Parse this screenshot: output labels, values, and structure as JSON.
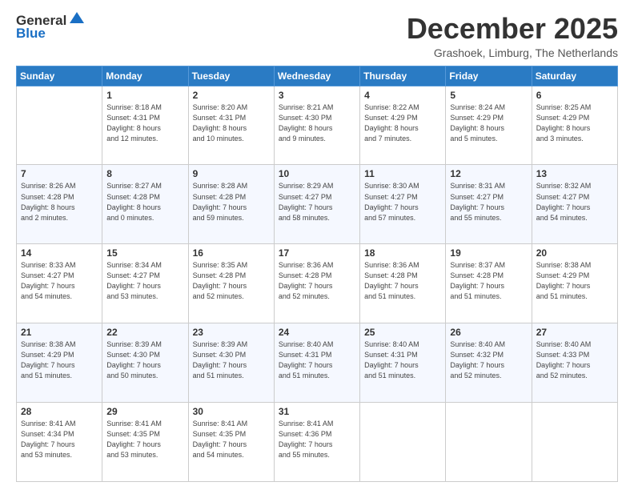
{
  "logo": {
    "line1": "General",
    "line2": "Blue"
  },
  "title": "December 2025",
  "location": "Grashoek, Limburg, The Netherlands",
  "days_of_week": [
    "Sunday",
    "Monday",
    "Tuesday",
    "Wednesday",
    "Thursday",
    "Friday",
    "Saturday"
  ],
  "weeks": [
    [
      {
        "day": "",
        "info": ""
      },
      {
        "day": "1",
        "info": "Sunrise: 8:18 AM\nSunset: 4:31 PM\nDaylight: 8 hours\nand 12 minutes."
      },
      {
        "day": "2",
        "info": "Sunrise: 8:20 AM\nSunset: 4:31 PM\nDaylight: 8 hours\nand 10 minutes."
      },
      {
        "day": "3",
        "info": "Sunrise: 8:21 AM\nSunset: 4:30 PM\nDaylight: 8 hours\nand 9 minutes."
      },
      {
        "day": "4",
        "info": "Sunrise: 8:22 AM\nSunset: 4:29 PM\nDaylight: 8 hours\nand 7 minutes."
      },
      {
        "day": "5",
        "info": "Sunrise: 8:24 AM\nSunset: 4:29 PM\nDaylight: 8 hours\nand 5 minutes."
      },
      {
        "day": "6",
        "info": "Sunrise: 8:25 AM\nSunset: 4:29 PM\nDaylight: 8 hours\nand 3 minutes."
      }
    ],
    [
      {
        "day": "7",
        "info": "Sunrise: 8:26 AM\nSunset: 4:28 PM\nDaylight: 8 hours\nand 2 minutes."
      },
      {
        "day": "8",
        "info": "Sunrise: 8:27 AM\nSunset: 4:28 PM\nDaylight: 8 hours\nand 0 minutes."
      },
      {
        "day": "9",
        "info": "Sunrise: 8:28 AM\nSunset: 4:28 PM\nDaylight: 7 hours\nand 59 minutes."
      },
      {
        "day": "10",
        "info": "Sunrise: 8:29 AM\nSunset: 4:27 PM\nDaylight: 7 hours\nand 58 minutes."
      },
      {
        "day": "11",
        "info": "Sunrise: 8:30 AM\nSunset: 4:27 PM\nDaylight: 7 hours\nand 57 minutes."
      },
      {
        "day": "12",
        "info": "Sunrise: 8:31 AM\nSunset: 4:27 PM\nDaylight: 7 hours\nand 55 minutes."
      },
      {
        "day": "13",
        "info": "Sunrise: 8:32 AM\nSunset: 4:27 PM\nDaylight: 7 hours\nand 54 minutes."
      }
    ],
    [
      {
        "day": "14",
        "info": "Sunrise: 8:33 AM\nSunset: 4:27 PM\nDaylight: 7 hours\nand 54 minutes."
      },
      {
        "day": "15",
        "info": "Sunrise: 8:34 AM\nSunset: 4:27 PM\nDaylight: 7 hours\nand 53 minutes."
      },
      {
        "day": "16",
        "info": "Sunrise: 8:35 AM\nSunset: 4:28 PM\nDaylight: 7 hours\nand 52 minutes."
      },
      {
        "day": "17",
        "info": "Sunrise: 8:36 AM\nSunset: 4:28 PM\nDaylight: 7 hours\nand 52 minutes."
      },
      {
        "day": "18",
        "info": "Sunrise: 8:36 AM\nSunset: 4:28 PM\nDaylight: 7 hours\nand 51 minutes."
      },
      {
        "day": "19",
        "info": "Sunrise: 8:37 AM\nSunset: 4:28 PM\nDaylight: 7 hours\nand 51 minutes."
      },
      {
        "day": "20",
        "info": "Sunrise: 8:38 AM\nSunset: 4:29 PM\nDaylight: 7 hours\nand 51 minutes."
      }
    ],
    [
      {
        "day": "21",
        "info": "Sunrise: 8:38 AM\nSunset: 4:29 PM\nDaylight: 7 hours\nand 51 minutes."
      },
      {
        "day": "22",
        "info": "Sunrise: 8:39 AM\nSunset: 4:30 PM\nDaylight: 7 hours\nand 50 minutes."
      },
      {
        "day": "23",
        "info": "Sunrise: 8:39 AM\nSunset: 4:30 PM\nDaylight: 7 hours\nand 51 minutes."
      },
      {
        "day": "24",
        "info": "Sunrise: 8:40 AM\nSunset: 4:31 PM\nDaylight: 7 hours\nand 51 minutes."
      },
      {
        "day": "25",
        "info": "Sunrise: 8:40 AM\nSunset: 4:31 PM\nDaylight: 7 hours\nand 51 minutes."
      },
      {
        "day": "26",
        "info": "Sunrise: 8:40 AM\nSunset: 4:32 PM\nDaylight: 7 hours\nand 52 minutes."
      },
      {
        "day": "27",
        "info": "Sunrise: 8:40 AM\nSunset: 4:33 PM\nDaylight: 7 hours\nand 52 minutes."
      }
    ],
    [
      {
        "day": "28",
        "info": "Sunrise: 8:41 AM\nSunset: 4:34 PM\nDaylight: 7 hours\nand 53 minutes."
      },
      {
        "day": "29",
        "info": "Sunrise: 8:41 AM\nSunset: 4:35 PM\nDaylight: 7 hours\nand 53 minutes."
      },
      {
        "day": "30",
        "info": "Sunrise: 8:41 AM\nSunset: 4:35 PM\nDaylight: 7 hours\nand 54 minutes."
      },
      {
        "day": "31",
        "info": "Sunrise: 8:41 AM\nSunset: 4:36 PM\nDaylight: 7 hours\nand 55 minutes."
      },
      {
        "day": "",
        "info": ""
      },
      {
        "day": "",
        "info": ""
      },
      {
        "day": "",
        "info": ""
      }
    ]
  ]
}
